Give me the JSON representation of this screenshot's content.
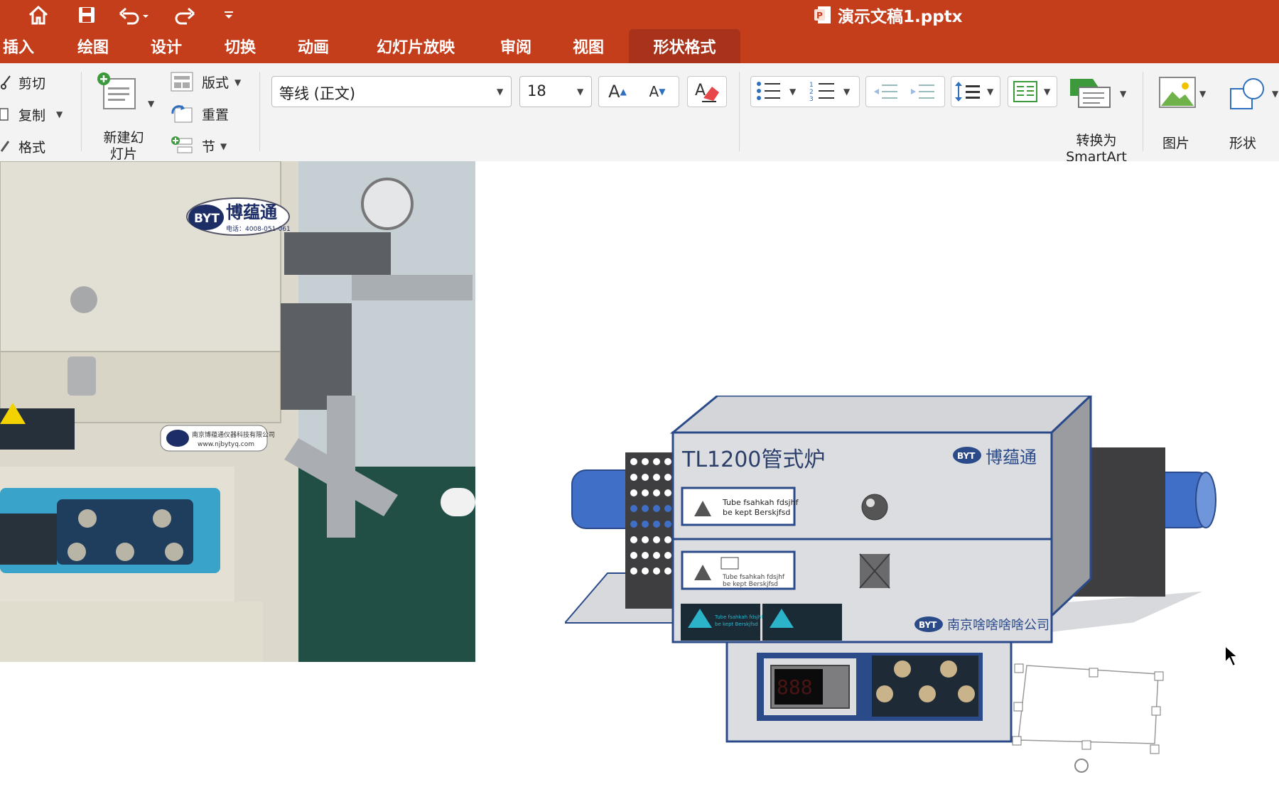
{
  "window": {
    "title": "演示文稿1.pptx"
  },
  "quick_access": {
    "icons": [
      "home-icon",
      "save-icon",
      "undo-icon",
      "redo-icon",
      "customize-icon"
    ]
  },
  "tabs": [
    "插入",
    "绘图",
    "设计",
    "切换",
    "动画",
    "幻灯片放映",
    "审阅",
    "视图",
    "形状格式"
  ],
  "active_tab": "形状格式",
  "ribbon": {
    "clipboard": {
      "cut": "剪切",
      "copy": "复制",
      "format": "格式"
    },
    "slides": {
      "new_slide": "新建幻灯片",
      "layout": "版式",
      "reset": "重置",
      "section": "节"
    },
    "font": {
      "name": "等线 (正文)",
      "size": "18"
    },
    "convert_smartart": "转换为SmartArt",
    "picture": "图片",
    "shape": "形状"
  },
  "colors": {
    "accent": "#c43e1c",
    "active_tab": "#a8321a",
    "highlight": "#ffee00",
    "font_color": "#000000",
    "furnace_blue": "#3f6fc6"
  },
  "slide": {
    "photo": {
      "brand": "博蕴通",
      "logo": "BYT",
      "phone": "电话：4008-051-061",
      "plate_company": "南京博蕴通仪器科技有限公司",
      "plate_url": "www.njbytyq.com"
    },
    "drawing": {
      "title": "TL1200管式炉",
      "brand": "博蕴通",
      "logo": "BYT",
      "company": "南京啥啥啥啥公司",
      "warn1_line1": "Tube fsahkah fdsjhf",
      "warn1_line2": "be kept Berskjfsd",
      "warn2_line1": "Tube fsahkah fdsjhf",
      "warn2_line2": "be kept Berskjfsd",
      "warn3_line1": "Tube fsahkah fdsjhf",
      "warn3_line2": "be kept Berskjfsd",
      "display": "888"
    }
  }
}
